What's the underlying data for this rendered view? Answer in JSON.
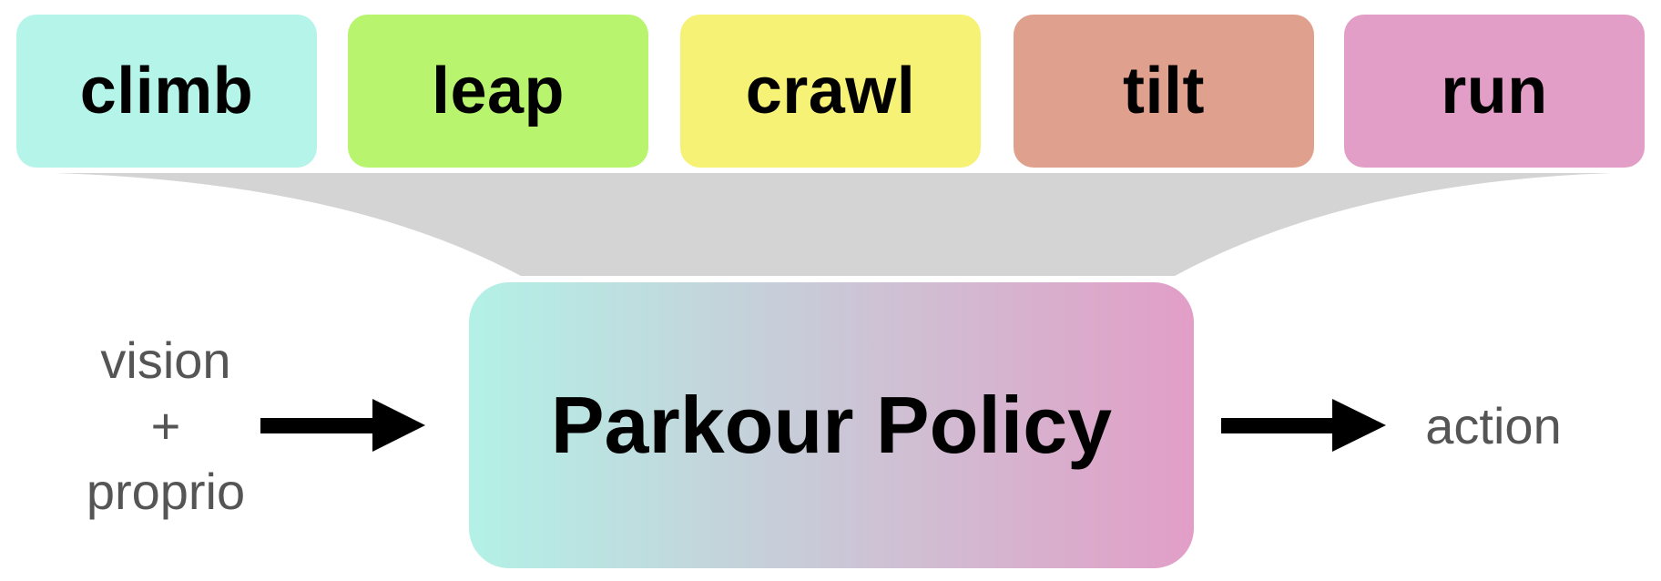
{
  "skills": [
    {
      "label": "climb",
      "color": "#b5f4e9"
    },
    {
      "label": "leap",
      "color": "#b9f46f"
    },
    {
      "label": "crawl",
      "color": "#f6f276"
    },
    {
      "label": "tilt",
      "color": "#e0a08e"
    },
    {
      "label": "run",
      "color": "#e29ec7"
    }
  ],
  "policy": {
    "label": "Parkour Policy",
    "gradient_start": "#b3f1e6",
    "gradient_end": "#e29ec7"
  },
  "input": {
    "line1": "vision",
    "line2": "+",
    "line3": "proprio"
  },
  "output": {
    "label": "action"
  },
  "colors": {
    "funnel": "#d4d4d4",
    "arrow": "#000000",
    "side_text": "#555555"
  }
}
